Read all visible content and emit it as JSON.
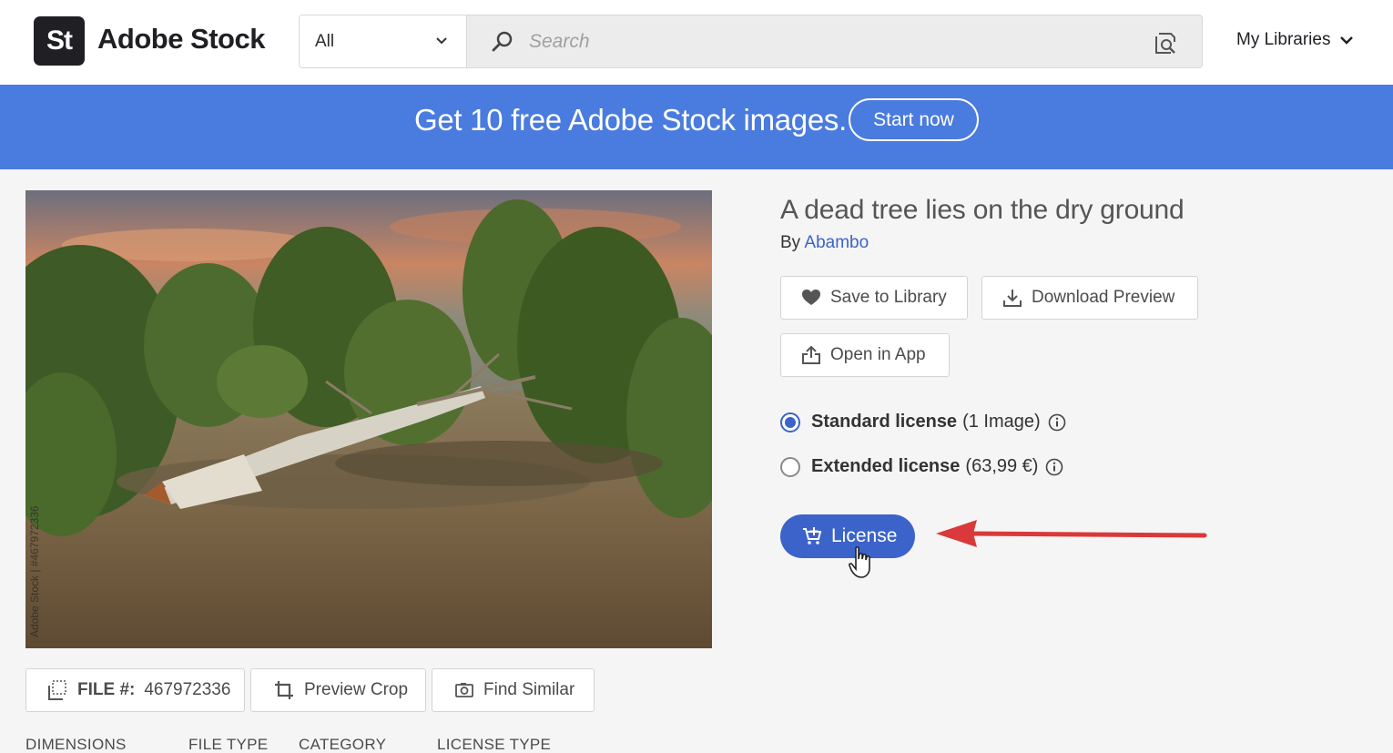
{
  "header": {
    "logo_mark": "St",
    "logo_text": "Adobe Stock",
    "search": {
      "category": "All",
      "placeholder": "Search",
      "search_icon": "search-icon",
      "visual_search_icon": "visual-search-icon"
    },
    "my_libraries": "My Libraries"
  },
  "banner": {
    "text": "Get 10 free Adobe Stock images.",
    "cta": "Start now"
  },
  "asset": {
    "watermark": "Adobe Stock | #467972336",
    "title": "A dead tree lies on the dry ground",
    "by_label": "By",
    "author": "Abambo",
    "actions": {
      "save": "Save to Library",
      "download": "Download Preview",
      "open": "Open in App"
    },
    "licenses": [
      {
        "name": "Standard license",
        "detail": "(1 Image)",
        "selected": true
      },
      {
        "name": "Extended license",
        "detail": "(63,99 €)",
        "selected": false
      }
    ],
    "license_button": "License",
    "file_label": "FILE #:",
    "file_number": "467972336",
    "preview_crop": "Preview Crop",
    "find_similar": "Find Similar",
    "details_headers": [
      "DIMENSIONS",
      "FILE TYPE",
      "CATEGORY",
      "LICENSE TYPE"
    ]
  },
  "colors": {
    "brand_blue": "#4a7bde",
    "button_blue": "#3b63c9",
    "annotation_red": "#d9393a"
  }
}
